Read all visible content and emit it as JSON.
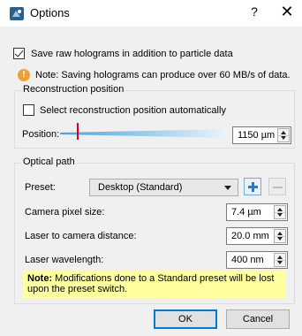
{
  "window": {
    "title": "Options",
    "help_label": "?",
    "close_label": "✕",
    "accent": "#0078d7"
  },
  "general": {
    "save_raw_label": "Save raw holograms in addition to particle data",
    "save_raw_checked": true,
    "note_text": "Note: Saving holograms can produce over 60 MB/s of data.",
    "note_icon": "warning-icon"
  },
  "reconstruction": {
    "group_title": "Reconstruction position",
    "auto_label": "Select reconstruction position automatically",
    "auto_checked": false,
    "position_label": "Position:",
    "position_value": "1150 µm",
    "slider_fraction": 0.1
  },
  "optical": {
    "group_title": "Optical path",
    "preset_label": "Preset:",
    "preset_value": "Desktop (Standard)",
    "camera_pixel_label": "Camera pixel size:",
    "camera_pixel_value": "7.4 µm",
    "laser_distance_label": "Laser to camera distance:",
    "laser_distance_value": "20.0 mm",
    "wavelength_label": "Laser wavelength:",
    "wavelength_value": "400 nm",
    "warning_bold": "Note:",
    "warning_text": " Modifications done to a Standard preset will be lost upon the preset switch."
  },
  "buttons": {
    "ok_label": "OK",
    "cancel_label": "Cancel"
  }
}
